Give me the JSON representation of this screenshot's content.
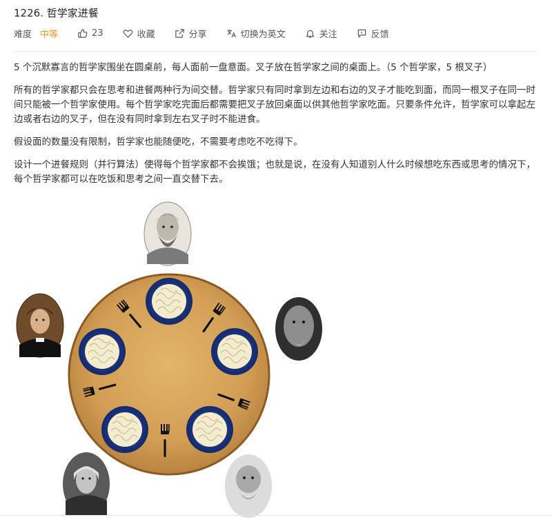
{
  "problem": {
    "title": "1226. 哲学家进餐",
    "difficulty_label": "难度",
    "difficulty_value": "中等",
    "likes": "23",
    "favorite_label": "收藏",
    "share_label": "分享",
    "translate_label": "切换为英文",
    "follow_label": "关注",
    "feedback_label": "反馈"
  },
  "description": {
    "p1": "5 个沉默寡言的哲学家围坐在圆桌前，每人面前一盘意面。叉子放在哲学家之间的桌面上。（5 个哲学家，5 根叉子）",
    "p2": "所有的哲学家都只会在思考和进餐两种行为间交替。哲学家只有同时拿到左边和右边的叉子才能吃到面，而同一根叉子在同一时间只能被一个哲学家使用。每个哲学家吃完面后都需要把叉子放回桌面以供其他哲学家吃面。只要条件允许，哲学家可以拿起左边或者右边的叉子，但在没有同时拿到左右叉子时不能进食。",
    "p3": "假设面的数量没有限制，哲学家也能随便吃，不需要考虑吃不吃得下。",
    "p4": "设计一个进餐规则（并行算法）使得每个哲学家都不会挨饿；也就是说，在没有人知道别人什么时候想吃东西或思考的情况下，每个哲学家都可以在吃饭和思考之间一直交替下去。"
  },
  "colors": {
    "accent_orange": "#f59a23",
    "table_wood": "#d9a45a",
    "plate_blue": "#1f3f93",
    "text_gray": "#595959"
  },
  "icons": [
    "thumbs-up-icon",
    "heart-icon",
    "share-icon",
    "translate-icon",
    "bell-icon",
    "feedback-icon"
  ]
}
